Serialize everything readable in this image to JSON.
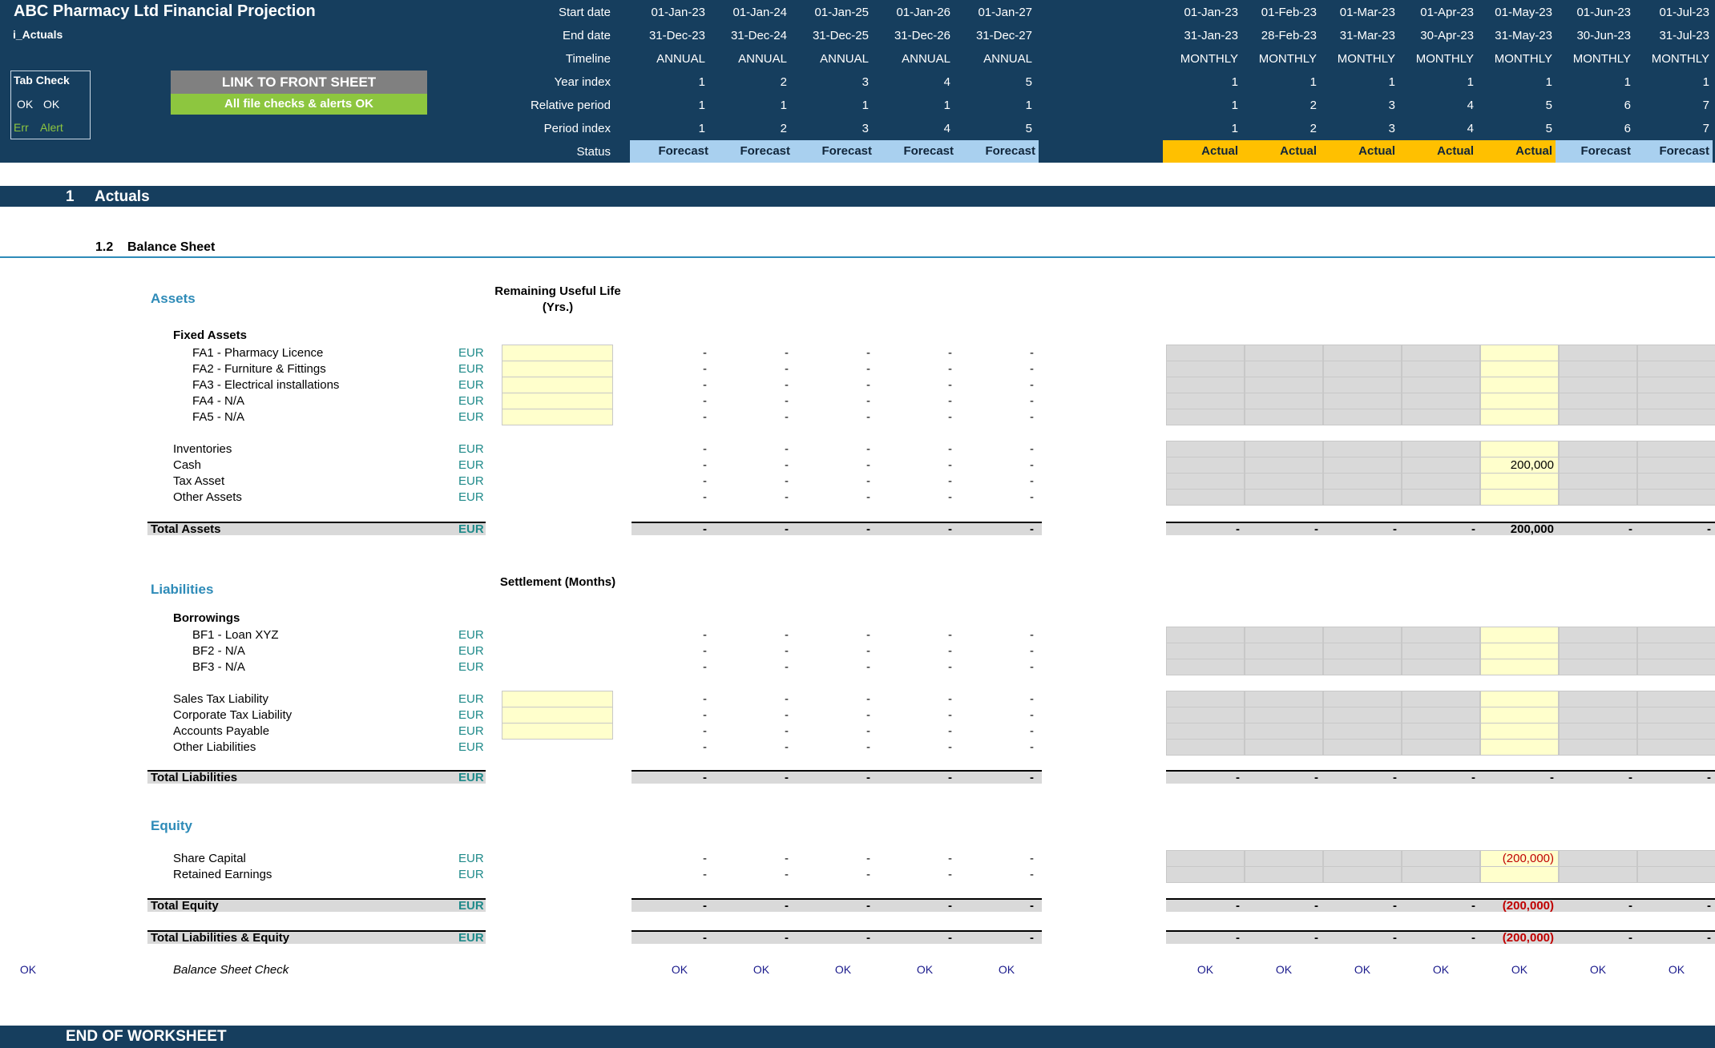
{
  "header": {
    "title": "ABC Pharmacy Ltd Financial Projection",
    "sheet": "i_Actuals",
    "row_labels": {
      "start": "Start date",
      "end": "End date",
      "timeline": "Timeline",
      "year_index": "Year index",
      "relative": "Relative period",
      "period_index": "Period index",
      "status": "Status"
    },
    "annual_columns": [
      {
        "start": "01-Jan-23",
        "end": "31-Dec-23",
        "timeline": "ANNUAL",
        "year_index": "1",
        "relative": "1",
        "period_index": "1",
        "status": "Forecast"
      },
      {
        "start": "01-Jan-24",
        "end": "31-Dec-24",
        "timeline": "ANNUAL",
        "year_index": "2",
        "relative": "1",
        "period_index": "2",
        "status": "Forecast"
      },
      {
        "start": "01-Jan-25",
        "end": "31-Dec-25",
        "timeline": "ANNUAL",
        "year_index": "3",
        "relative": "1",
        "period_index": "3",
        "status": "Forecast"
      },
      {
        "start": "01-Jan-26",
        "end": "31-Dec-26",
        "timeline": "ANNUAL",
        "year_index": "4",
        "relative": "1",
        "period_index": "4",
        "status": "Forecast"
      },
      {
        "start": "01-Jan-27",
        "end": "31-Dec-27",
        "timeline": "ANNUAL",
        "year_index": "5",
        "relative": "1",
        "period_index": "5",
        "status": "Forecast"
      }
    ],
    "monthly_columns": [
      {
        "start": "01-Jan-23",
        "end": "31-Jan-23",
        "timeline": "MONTHLY",
        "year_index": "1",
        "relative": "1",
        "period_index": "1",
        "status": "Actual"
      },
      {
        "start": "01-Feb-23",
        "end": "28-Feb-23",
        "timeline": "MONTHLY",
        "year_index": "1",
        "relative": "2",
        "period_index": "2",
        "status": "Actual"
      },
      {
        "start": "01-Mar-23",
        "end": "31-Mar-23",
        "timeline": "MONTHLY",
        "year_index": "1",
        "relative": "3",
        "period_index": "3",
        "status": "Actual"
      },
      {
        "start": "01-Apr-23",
        "end": "30-Apr-23",
        "timeline": "MONTHLY",
        "year_index": "1",
        "relative": "4",
        "period_index": "4",
        "status": "Actual"
      },
      {
        "start": "01-May-23",
        "end": "31-May-23",
        "timeline": "MONTHLY",
        "year_index": "1",
        "relative": "5",
        "period_index": "5",
        "status": "Actual"
      },
      {
        "start": "01-Jun-23",
        "end": "30-Jun-23",
        "timeline": "MONTHLY",
        "year_index": "1",
        "relative": "6",
        "period_index": "6",
        "status": "Forecast"
      },
      {
        "start": "01-Jul-23",
        "end": "31-Jul-23",
        "timeline": "MONTHLY",
        "year_index": "1",
        "relative": "7",
        "period_index": "7",
        "status": "Forecast"
      }
    ],
    "colors": {
      "header_bg": "#163e5e",
      "forecast": "#a9d0ef",
      "actual": "#ffc000",
      "input": "#ffffcc"
    }
  },
  "tab_check": {
    "title": "Tab Check",
    "ok1": "OK",
    "ok2": "OK",
    "err": "Err",
    "alert": "Alert"
  },
  "buttons": {
    "link": "LINK TO FRONT SHEET",
    "checks": "All file checks & alerts OK"
  },
  "section": {
    "num": "1",
    "title": "Actuals"
  },
  "subsection": {
    "num": "1.2",
    "title": "Balance Sheet"
  },
  "assets": {
    "title": "Assets",
    "col_head": "Remaining Useful Life (Yrs.)",
    "fixed_title": "Fixed Assets",
    "rows": [
      {
        "label": "FA1 - Pharmacy Licence",
        "unit": "EUR"
      },
      {
        "label": "FA2 - Furniture & Fittings",
        "unit": "EUR"
      },
      {
        "label": "FA3 - Electrical installations",
        "unit": "EUR"
      },
      {
        "label": "FA4 - N/A",
        "unit": "EUR"
      },
      {
        "label": "FA5 - N/A",
        "unit": "EUR"
      },
      {
        "label": "Inventories",
        "unit": "EUR"
      },
      {
        "label": "Cash",
        "unit": "EUR",
        "may": "200,000"
      },
      {
        "label": "Tax Asset",
        "unit": "EUR"
      },
      {
        "label": "Other Assets",
        "unit": "EUR"
      }
    ],
    "total": {
      "label": "Total Assets",
      "unit": "EUR",
      "monthly": [
        "-",
        "-",
        "-",
        "-",
        "200,000",
        "-",
        "-"
      ]
    }
  },
  "liabilities": {
    "title": "Liabilities",
    "col_head": "Settlement (Months)",
    "borrow_title": "Borrowings",
    "rows": [
      {
        "label": "BF1 - Loan XYZ",
        "unit": "EUR"
      },
      {
        "label": "BF2 - N/A",
        "unit": "EUR"
      },
      {
        "label": "BF3 - N/A",
        "unit": "EUR"
      },
      {
        "label": "Sales Tax Liability",
        "unit": "EUR"
      },
      {
        "label": "Corporate Tax Liability",
        "unit": "EUR"
      },
      {
        "label": "Accounts Payable",
        "unit": "EUR"
      },
      {
        "label": "Other Liabilities",
        "unit": "EUR"
      }
    ],
    "total": {
      "label": "Total Liabilities",
      "unit": "EUR",
      "monthly": [
        "-",
        "-",
        "-",
        "-",
        "-",
        "-",
        "-"
      ]
    }
  },
  "equity": {
    "title": "Equity",
    "rows": [
      {
        "label": "Share Capital",
        "unit": "EUR",
        "may": "(200,000)"
      },
      {
        "label": "Retained Earnings",
        "unit": "EUR"
      }
    ],
    "total": {
      "label": "Total Equity",
      "unit": "EUR",
      "monthly": [
        "-",
        "-",
        "-",
        "-",
        "(200,000)",
        "-",
        "-"
      ]
    },
    "total_le": {
      "label": "Total Liabilities & Equity",
      "unit": "EUR",
      "monthly": [
        "-",
        "-",
        "-",
        "-",
        "(200,000)",
        "-",
        "-"
      ]
    }
  },
  "check": {
    "left_ok": "OK",
    "label": "Balance Sheet Check",
    "value": "OK"
  },
  "dash": "-",
  "end": "END OF WORKSHEET"
}
